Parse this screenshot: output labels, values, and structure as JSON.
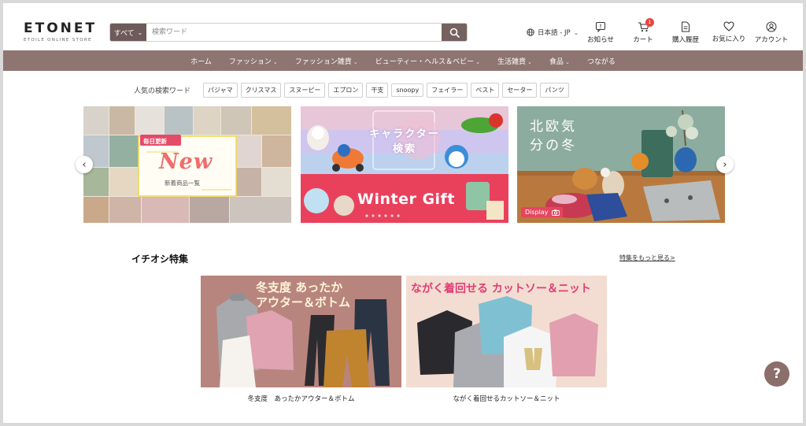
{
  "header": {
    "logo": "ETONET",
    "logo_sub": "ETOILE ONLINE STORE",
    "search_category": "すべて",
    "search_placeholder": "検索ワード",
    "language": "日本語 - JP",
    "icons": {
      "notice": "お知らせ",
      "cart": "カート",
      "cart_count": "1",
      "history": "購入履歴",
      "favorite": "お気に入り",
      "account": "アカウント"
    }
  },
  "nav": {
    "items": [
      "ホーム",
      "ファッション",
      "ファッション雑貨",
      "ビューティー・ヘルス＆ベビー",
      "生活雑貨",
      "食品",
      "つながる"
    ]
  },
  "popular": {
    "label": "人気の検索ワード",
    "tags": [
      "パジャマ",
      "クリスマス",
      "スヌーピー",
      "エプロン",
      "干支",
      "snoopy",
      "フェイラー",
      "ベスト",
      "セーター",
      "パンツ"
    ]
  },
  "banners": {
    "b1_badge": "毎日更新",
    "b1_new": "New",
    "b1_sub": "新着商品一覧",
    "b2_top_line1": "キャラクター",
    "b2_top_line2": "検索",
    "b2_bottom": "Winter Gift",
    "b3_text": "北欧気分の冬",
    "b3_badge": "Display"
  },
  "features": {
    "title": "イチオシ特集",
    "more": "特集をもっと見る>",
    "cards": [
      {
        "headline_line1": "冬支度 あったか",
        "headline_line2": "アウター＆ボトム",
        "caption": "冬支度　あったかアウター＆ボトム"
      },
      {
        "headline": "ながく着回せる カットソー＆ニット",
        "caption": "ながく着回せるカットソー＆ニット"
      }
    ]
  },
  "help": "?",
  "colors": {
    "brand": "#8e7571",
    "search_button": "#75615e",
    "badge": "#e7473c"
  }
}
